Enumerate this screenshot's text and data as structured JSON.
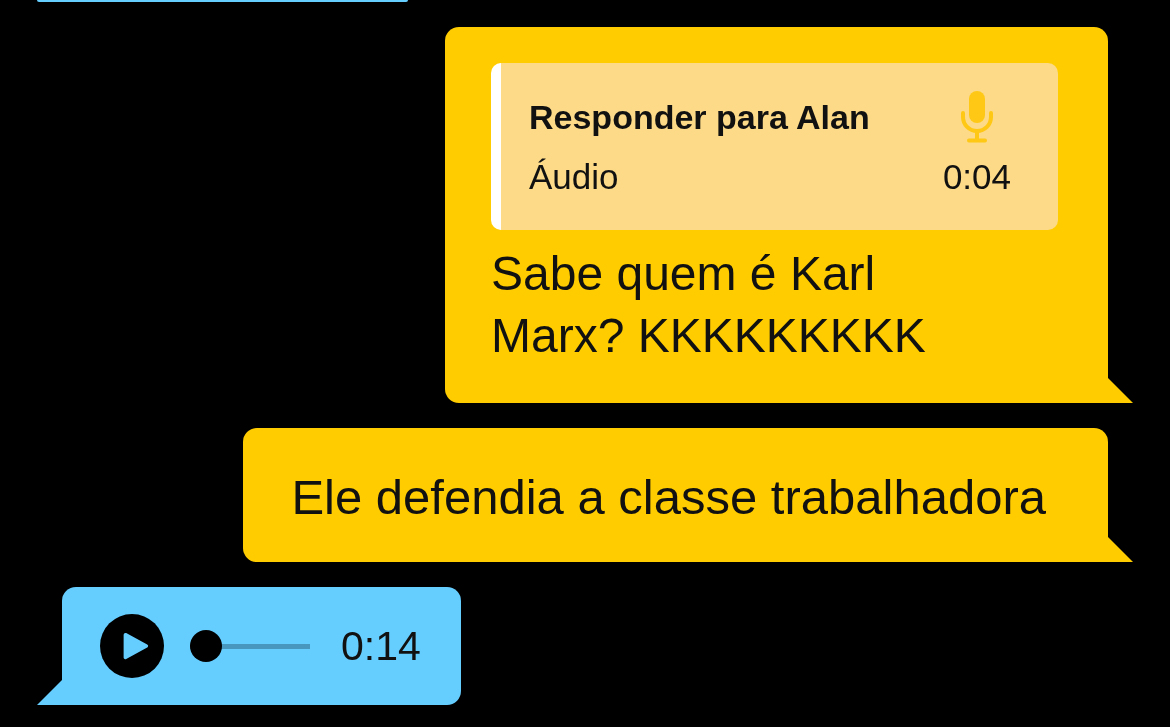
{
  "messages": [
    {
      "kind": "clipped",
      "outgoing": false
    },
    {
      "kind": "reply",
      "outgoing": true,
      "reply_to": {
        "title": "Responder para Alan",
        "label": "Áudio",
        "duration": "0:04"
      },
      "text": "Sabe quem é Karl Marx? KKKKKKKKK"
    },
    {
      "kind": "text",
      "outgoing": true,
      "text": "Ele defendia a classe trabalhadora"
    },
    {
      "kind": "audio",
      "outgoing": false,
      "level": 0,
      "duration": "0:14"
    }
  ]
}
